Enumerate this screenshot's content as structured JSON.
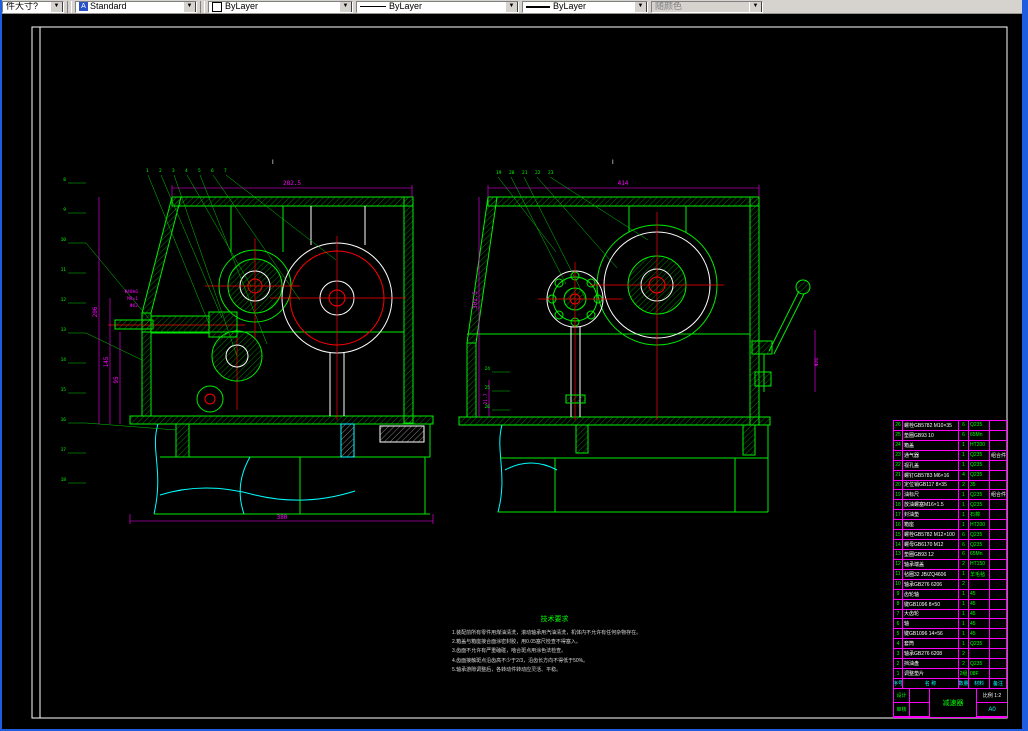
{
  "toolbar": {
    "style_combo_label": "件大寸?",
    "text_style": "Standard",
    "color": "ByLayer",
    "linetype": "ByLayer",
    "lineweight": "ByLayer",
    "plot_style": "随颜色"
  },
  "views": {
    "left": {
      "dim_top": "282.5",
      "dim_bottom": "380",
      "dim_left_outer": "206",
      "dim_left_mid": "145",
      "dim_left_inner": "95",
      "small_labels": [
        "Φ40k6",
        "M8×1",
        "Φ62"
      ],
      "section_mark": "I",
      "callouts_top": [
        "1",
        "2",
        "3",
        "4",
        "5",
        "6",
        "7"
      ],
      "callouts_left": [
        "8",
        "9",
        "10",
        "11",
        "12",
        "13",
        "14",
        "15",
        "16",
        "17",
        "18"
      ]
    },
    "right": {
      "dim_top": "414",
      "dim_left": "302.5",
      "dim_left_small": "21.7",
      "dim_right": "Φ20",
      "section_mark": "I",
      "callouts_top": [
        "19",
        "20",
        "21",
        "22",
        "23"
      ],
      "callouts_left": [
        "24",
        "25",
        "26"
      ]
    }
  },
  "notes": {
    "title": "技术要求",
    "lines": [
      "1.装配前所有零件用煤油清洗，滚动轴承用汽油清洗，机体内不允许有任何杂物存在。",
      "2.箱盖与箱座接合面涂密封胶，用0.05塞尺检查不得塞入。",
      "3.齿面不允许有严重磕碰，啮合斑点用涂色法检查。",
      "4.齿面接触斑点沿齿高不少于2/3，沿齿长方向不得低于50%。",
      "5.轴承游隙调整后，各转动件转动应灵活、平稳。"
    ]
  },
  "parts_table": {
    "headers": [
      "序号",
      "名  称",
      "数量",
      "材料",
      "备注"
    ],
    "rows": [
      [
        "26",
        "螺栓GB5782 M10×35",
        "6",
        "Q235",
        ""
      ],
      [
        "25",
        "垫圈GB93 10",
        "6",
        "65Mn",
        ""
      ],
      [
        "24",
        "箱盖",
        "1",
        "HT200",
        ""
      ],
      [
        "23",
        "通气器",
        "1",
        "Q235",
        "组合件"
      ],
      [
        "22",
        "视孔盖",
        "1",
        "Q235",
        ""
      ],
      [
        "21",
        "螺钉GB5783 M6×16",
        "4",
        "Q235",
        ""
      ],
      [
        "20",
        "定位销GB117 8×35",
        "2",
        "35",
        ""
      ],
      [
        "19",
        "油标尺",
        "1",
        "Q235",
        "组合件"
      ],
      [
        "18",
        "放油螺塞M16×1.5",
        "1",
        "Q235",
        ""
      ],
      [
        "17",
        "封油垫",
        "1",
        "石棉",
        ""
      ],
      [
        "16",
        "箱座",
        "1",
        "HT200",
        ""
      ],
      [
        "15",
        "螺栓GB5782 M12×100",
        "6",
        "Q235",
        ""
      ],
      [
        "14",
        "螺母GB6170 M12",
        "6",
        "Q235",
        ""
      ],
      [
        "13",
        "垫圈GB93 12",
        "6",
        "65Mn",
        ""
      ],
      [
        "12",
        "轴承端盖",
        "2",
        "HT150",
        ""
      ],
      [
        "11",
        "毡圈32 JB/ZQ4606",
        "1",
        "羊毛毡",
        ""
      ],
      [
        "10",
        "轴承GB276 6206",
        "2",
        "",
        ""
      ],
      [
        "9",
        "齿轮轴",
        "1",
        "45",
        ""
      ],
      [
        "8",
        "键GB1096 8×50",
        "1",
        "45",
        ""
      ],
      [
        "7",
        "大齿轮",
        "1",
        "45",
        ""
      ],
      [
        "6",
        "轴",
        "1",
        "45",
        ""
      ],
      [
        "5",
        "键GB1096 14×56",
        "1",
        "45",
        ""
      ],
      [
        "4",
        "套筒",
        "1",
        "Q235",
        ""
      ],
      [
        "3",
        "轴承GB276 6208",
        "2",
        "",
        ""
      ],
      [
        "2",
        "挡油盘",
        "2",
        "Q235",
        ""
      ],
      [
        "1",
        "调整垫片",
        "2组",
        "08F",
        ""
      ]
    ]
  },
  "title_block": {
    "designer_label": "设计",
    "checker_label": "审核",
    "scale_label": "比例",
    "scale": "1:2",
    "sheet": "A0",
    "name": "减速器"
  }
}
